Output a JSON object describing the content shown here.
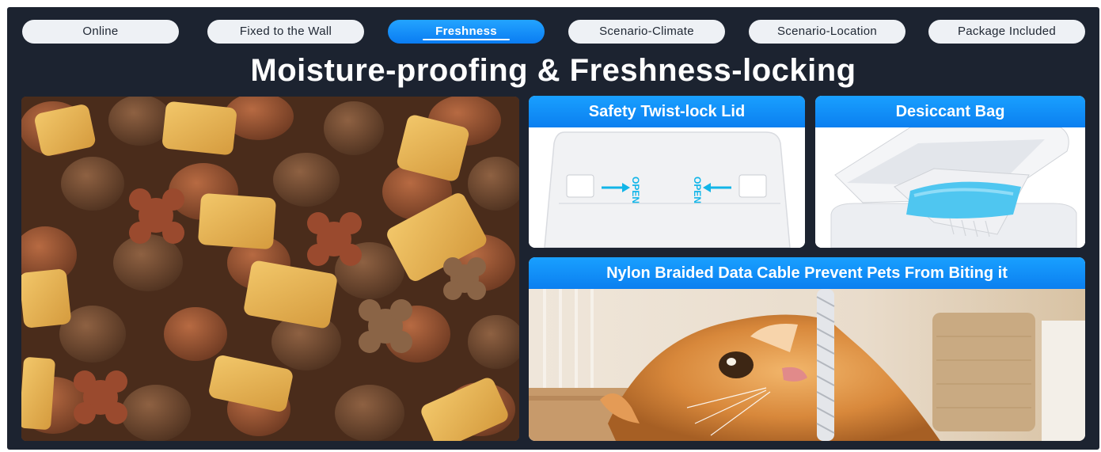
{
  "tabs": [
    {
      "label": "Online",
      "active": false
    },
    {
      "label": "Fixed to the Wall",
      "active": false
    },
    {
      "label": "Freshness",
      "active": true
    },
    {
      "label": "Scenario-Climate",
      "active": false
    },
    {
      "label": "Scenario-Location",
      "active": false
    },
    {
      "label": "Package Included",
      "active": false
    }
  ],
  "headline": "Moisture-proofing & Freshness-locking",
  "cards": {
    "lid": {
      "title": "Safety Twist-lock Lid",
      "open_left": "OPEN",
      "open_right": "OPEN"
    },
    "desiccant": {
      "title": "Desiccant Bag"
    },
    "cable": {
      "title": "Nylon Braided Data Cable Prevent Pets From Biting it"
    }
  },
  "colors": {
    "background": "#1c2330",
    "accent": "#0b7ff0",
    "accent_light": "#23a4ff",
    "tab_inactive": "#eef1f5",
    "arrow": "#12b5e8"
  },
  "icons": [
    "arrow-right-icon",
    "arrow-left-icon"
  ]
}
